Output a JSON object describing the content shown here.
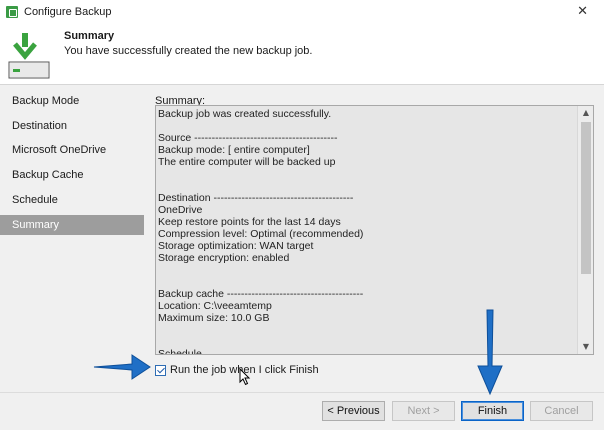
{
  "window": {
    "title": "Configure Backup",
    "close_glyph": "✕"
  },
  "header": {
    "title": "Summary",
    "subtitle": "You have successfully created the new backup job.",
    "icon": "download-drive-icon"
  },
  "sidebar": {
    "items": [
      {
        "label": "Backup Mode",
        "active": false
      },
      {
        "label": "Destination",
        "active": false
      },
      {
        "label": "Microsoft OneDrive",
        "active": false
      },
      {
        "label": "Backup Cache",
        "active": false
      },
      {
        "label": "Schedule",
        "active": false
      },
      {
        "label": "Summary",
        "active": true
      }
    ]
  },
  "main": {
    "summary_label": "Summary:",
    "summary_text": "Backup job was created successfully.\n\nSource -----------------------------------------\nBackup mode: [ entire computer]\nThe entire computer will be backed up\n\n\nDestination ----------------------------------------\nOneDrive\nKeep restore points for the last 14 days\nCompression level: Optimal (recommended)\nStorage optimization: WAN target\nStorage encryption: enabled\n\n\nBackup cache ---------------------------------------\nLocation: C:\\veeamtemp\nMaximum size: 10.0 GB\n\n\nSchedule",
    "checkbox_label": "Run the job when I click Finish",
    "checkbox_checked": true
  },
  "buttons": {
    "previous": "< Previous",
    "next": "Next >",
    "finish": "Finish",
    "cancel": "Cancel"
  },
  "colors": {
    "accent_arrow": "#1f6fc6",
    "sidebar_active": "#9d9d9d",
    "header_icon_green": "#3aa33f"
  }
}
